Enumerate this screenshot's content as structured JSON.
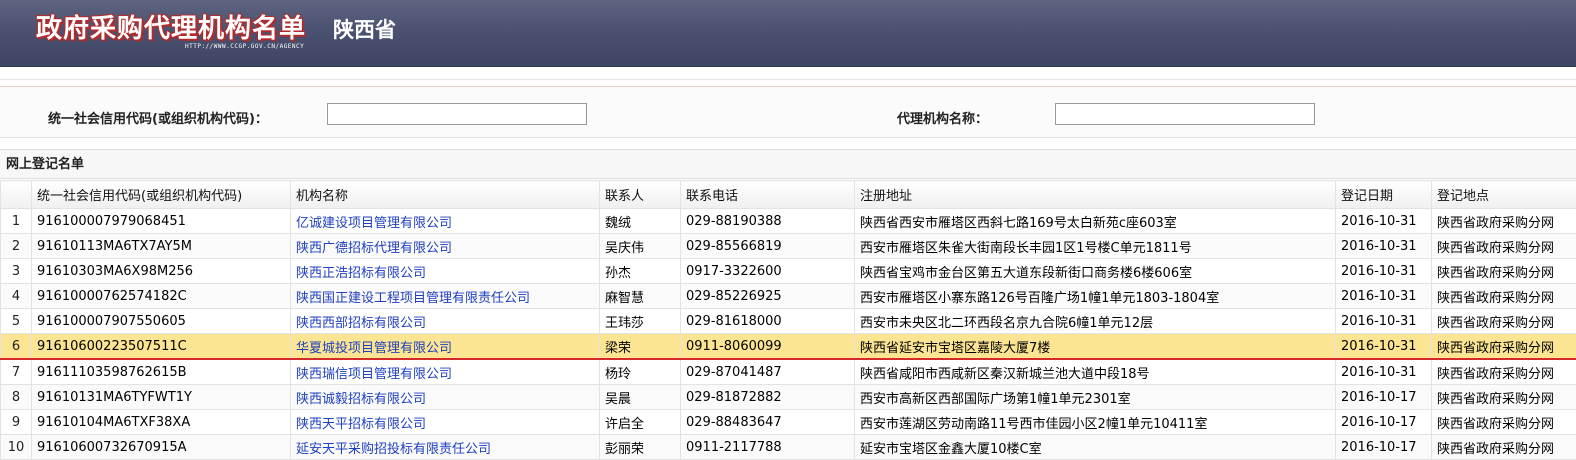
{
  "header": {
    "title": "政府采购代理机构名单",
    "province": "陕西省",
    "url": "HTTP://WWW.CCGP.GOV.CN/AGENCY"
  },
  "search": {
    "credit_code_label": "统一社会信用代码(或组织机构代码)：",
    "credit_code_value": "",
    "agency_name_label": "代理机构名称：",
    "agency_name_value": ""
  },
  "list": {
    "section_title": "网上登记名单",
    "columns": [
      "统一社会信用代码(或组织机构代码)",
      "机构名称",
      "联系人",
      "联系电话",
      "注册地址",
      "登记日期",
      "登记地点"
    ],
    "rows": [
      {
        "idx": "1",
        "code": "916100007979068451",
        "name": "亿诚建设项目管理有限公司",
        "contact": "魏绒",
        "phone": "029-88190388",
        "address": "陕西省西安市雁塔区西斜七路169号太白新苑c座603室",
        "date": "2016-10-31",
        "place": "陕西省政府采购分网"
      },
      {
        "idx": "2",
        "code": "91610113MA6TX7AY5M",
        "name": "陕西广德招标代理有限公司",
        "contact": "吴庆伟",
        "phone": "029-85566819",
        "address": "西安市雁塔区朱雀大街南段长丰园1区1号楼C单元1811号",
        "date": "2016-10-31",
        "place": "陕西省政府采购分网"
      },
      {
        "idx": "3",
        "code": "91610303MA6X98M256",
        "name": "陕西正浩招标有限公司",
        "contact": "孙杰",
        "phone": "0917-3322600",
        "address": "陕西省宝鸡市金台区第五大道东段新街口商务楼6楼606室",
        "date": "2016-10-31",
        "place": "陕西省政府采购分网"
      },
      {
        "idx": "4",
        "code": "91610000762574182C",
        "name": "陕西国正建设工程项目管理有限责任公司",
        "contact": "麻智慧",
        "phone": "029-85226925",
        "address": "西安市雁塔区小寨东路126号百隆广场1幢1单元1803-1804室",
        "date": "2016-10-31",
        "place": "陕西省政府采购分网"
      },
      {
        "idx": "5",
        "code": "916100007907550605",
        "name": "陕西西部招标有限公司",
        "contact": "王玮莎",
        "phone": "029-81618000",
        "address": "西安市未央区北二环西段名京九合院6幢1单元12层",
        "date": "2016-10-31",
        "place": "陕西省政府采购分网"
      },
      {
        "idx": "6",
        "code": "91610600223507511C",
        "name": "华夏城投项目管理有限公司",
        "contact": "梁荣",
        "phone": "0911-8060099",
        "address": "陕西省延安市宝塔区嘉陵大厦7楼",
        "date": "2016-10-31",
        "place": "陕西省政府采购分网"
      },
      {
        "idx": "7",
        "code": "91611103598762615B",
        "name": "陕西瑞信项目管理有限公司",
        "contact": "杨玲",
        "phone": "029-87041487",
        "address": "陕西省咸阳市西咸新区秦汉新城兰池大道中段18号",
        "date": "2016-10-31",
        "place": "陕西省政府采购分网"
      },
      {
        "idx": "8",
        "code": "91610131MA6TYFWT1Y",
        "name": "陕西诚毅招标有限公司",
        "contact": "吴晨",
        "phone": "029-81872882",
        "address": "西安市高新区西部国际广场第1幢1单元2301室",
        "date": "2016-10-17",
        "place": "陕西省政府采购分网"
      },
      {
        "idx": "9",
        "code": "91610104MA6TXF38XA",
        "name": "陕西天平招标有限公司",
        "contact": "许启全",
        "phone": "029-88483647",
        "address": "西安市莲湖区劳动南路11号西市佳园小区2幢1单元10411室",
        "date": "2016-10-17",
        "place": "陕西省政府采购分网"
      },
      {
        "idx": "10",
        "code": "91610600732670915A",
        "name": "延安天平采购招投标有限责任公司",
        "contact": "彭丽荣",
        "phone": "0911-2117788",
        "address": "延安市宝塔区金鑫大厦10楼C室",
        "date": "2016-10-17",
        "place": "陕西省政府采购分网"
      }
    ]
  }
}
